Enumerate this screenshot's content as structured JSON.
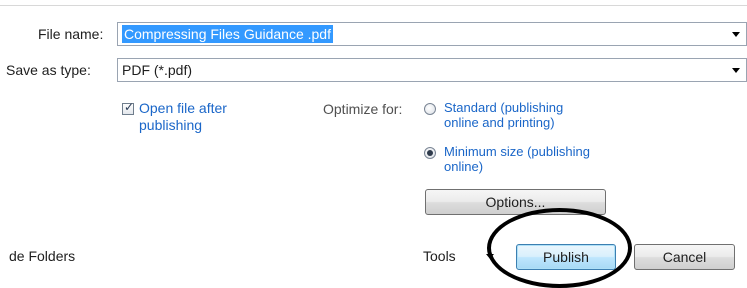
{
  "form": {
    "file_name_label": "File name:",
    "file_name_value": "Compressing Files Guidance .pdf",
    "save_as_type_label": "Save as type:",
    "save_as_type_value": "PDF (*.pdf)"
  },
  "options": {
    "open_after_label_line1": "Open file after",
    "open_after_label_line2": "publishing",
    "open_after_checked": true,
    "optimize_for_label": "Optimize for:",
    "standard_line1": "Standard (publishing",
    "standard_line2": "online and printing)",
    "standard_selected": false,
    "minimum_line1": "Minimum size (publishing",
    "minimum_line2": "online)",
    "minimum_selected": true,
    "options_button": "Options..."
  },
  "footer": {
    "hide_folders": "de Folders",
    "tools": "Tools",
    "publish_button": "Publish",
    "cancel_button": "Cancel"
  },
  "colors": {
    "selection": "#3399ff",
    "link_blue": "#1a66c8",
    "annotation_circle": "#000000"
  }
}
